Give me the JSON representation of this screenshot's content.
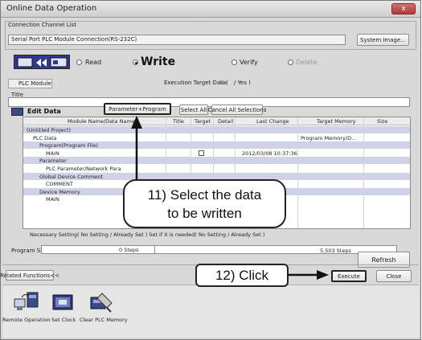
{
  "window": {
    "title": "Online Data Operation",
    "close_label": "x"
  },
  "connection": {
    "group_label": "Connection Channel List",
    "value": "Serial Port PLC Module Connection(RS-232C)",
    "system_image_label": "System Image..."
  },
  "mode": {
    "read_label": "Read",
    "write_label": "Write",
    "verify_label": "Verify",
    "delete_label": "Delete",
    "selected": "Write"
  },
  "plc_module": {
    "tab_label": "PLC Module",
    "execution_target_label": "Execution Target Data(",
    "no_label": "No",
    "yes_label": "/ Yes )"
  },
  "title_field": {
    "label": "Title",
    "value": ""
  },
  "edit_data": {
    "label": "Edit Data",
    "param_program_button": "Parameter+Program",
    "select_all_button": "Select All",
    "cancel_all_button": "Cancel All Selections"
  },
  "table": {
    "columns": [
      "Module Name/Data Name",
      "Title",
      "Target",
      "Detail",
      "Last Change",
      "Target Memory",
      "Size"
    ],
    "rows": [
      {
        "name": "(Untitled Project)",
        "indent": 0,
        "selected": true,
        "target": "",
        "last_change": "",
        "memory": ""
      },
      {
        "name": "PLC Data",
        "indent": 1,
        "selected": false,
        "target": "",
        "last_change": "",
        "memory": "Program Memory/D..."
      },
      {
        "name": "Program(Program File)",
        "indent": 2,
        "selected": true,
        "target": "",
        "last_change": "",
        "memory": ""
      },
      {
        "name": "MAIN",
        "indent": 3,
        "selected": false,
        "target": "checkbox",
        "last_change": "2012/03/08 10:37:36",
        "memory": ""
      },
      {
        "name": "Parameter",
        "indent": 2,
        "selected": true,
        "target": "",
        "last_change": "",
        "memory": ""
      },
      {
        "name": "PLC Parameter/Network Para",
        "indent": 3,
        "selected": false,
        "target": "",
        "last_change": "",
        "memory": ""
      },
      {
        "name": "Global Device Comment",
        "indent": 2,
        "selected": true,
        "target": "",
        "last_change": "",
        "memory": ""
      },
      {
        "name": "COMMENT",
        "indent": 3,
        "selected": false,
        "target": "",
        "last_change": "",
        "memory": ""
      },
      {
        "name": "Device Memory",
        "indent": 2,
        "selected": true,
        "target": "",
        "last_change": "",
        "memory": ""
      },
      {
        "name": "MAIN",
        "indent": 3,
        "selected": false,
        "target": "",
        "last_change": "",
        "memory": ""
      }
    ]
  },
  "necessary_setting": {
    "text": "Necessary Setting( No Setting /   Already Set )    Set if it is needed( No Setting /  Already Set )"
  },
  "program_size": {
    "label": "Program Size",
    "value": "0 Steps",
    "capacity": "5,503 Steps"
  },
  "refresh_label": "Refresh",
  "related_functions_label": "Related Functions<<",
  "execute_label": "Execute",
  "close_label": "Close",
  "functions": [
    {
      "label": "Remote Operation",
      "icon": "remote-operation-icon"
    },
    {
      "label": "Set Clock",
      "icon": "set-clock-icon"
    },
    {
      "label": "Clear PLC Memory",
      "icon": "clear-plc-memory-icon"
    }
  ],
  "callouts": {
    "select_line1": "11) Select the data",
    "select_line2": "to be written",
    "click": "12) Click"
  }
}
